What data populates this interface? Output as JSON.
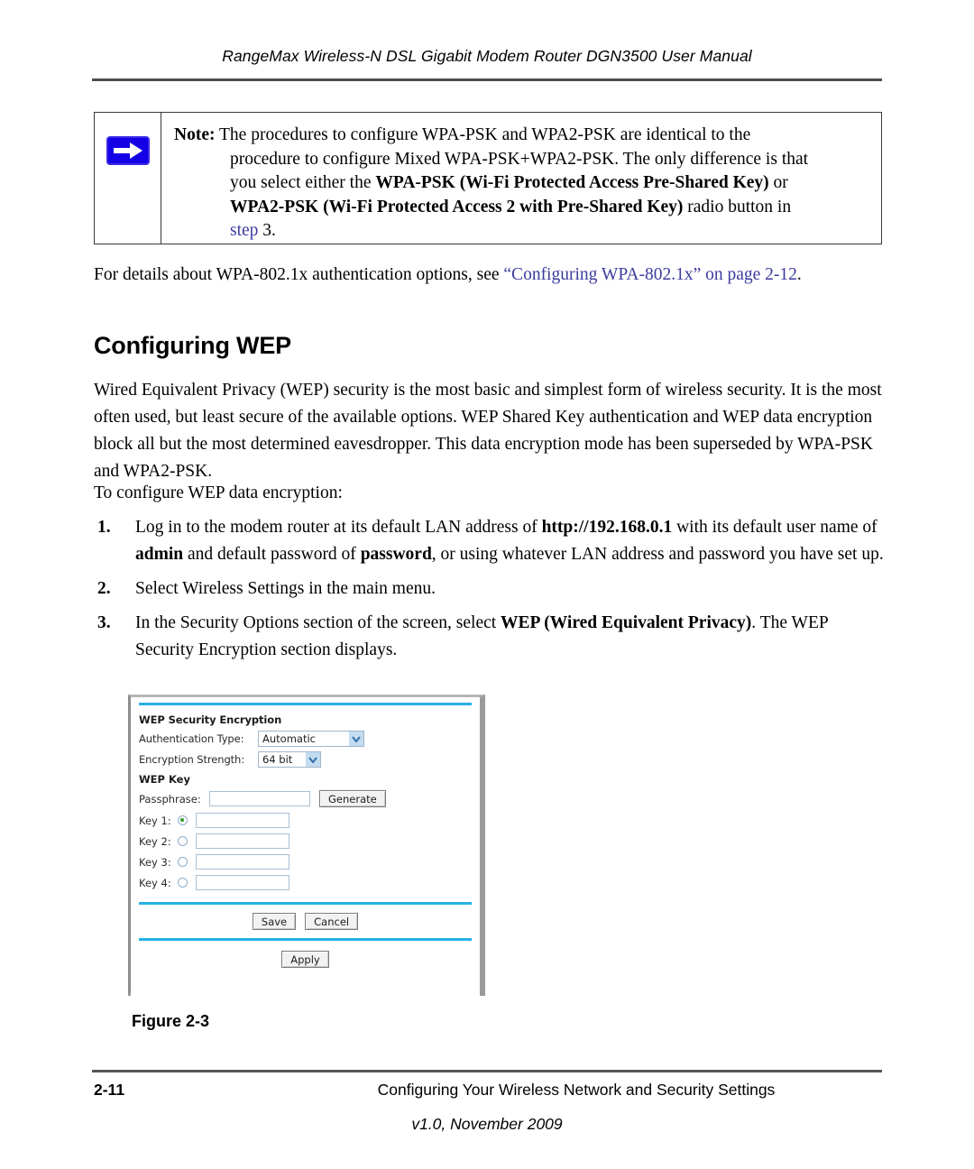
{
  "header": {
    "running_title": "RangeMax Wireless-N DSL Gigabit Modem Router DGN3500 User Manual"
  },
  "note": {
    "icon": "blue-right-arrow-icon",
    "label": "Note:",
    "line1_text": "The procedures to configure WPA-PSK and WPA2-PSK are identical to the",
    "line2_text": "procedure to configure Mixed WPA-PSK+WPA2-PSK. The only difference is that",
    "line3_prefix": "you select either the ",
    "line3_bold": "WPA-PSK (Wi-Fi Protected Access Pre-Shared Key)",
    "line3_suffix": " or",
    "line4_bold": "WPA2-PSK (Wi-Fi Protected Access 2 with Pre-Shared Key)",
    "line4_suffix": " radio button in",
    "line5_link": "step",
    "line5_rest": " 3."
  },
  "xref_para": {
    "before": "For details about WPA-802.1x authentication options, see ",
    "link1": "“Configuring WPA-802.1x” on",
    "link2": "page 2-12",
    "after": "."
  },
  "section": {
    "heading": "Configuring WEP"
  },
  "paragraphs": {
    "intro": "Wired Equivalent Privacy (WEP) security is the most basic and simplest form of wireless security. It is the most often used, but least secure of the available options. WEP Shared Key authentication and WEP data encryption block all but the most determined eavesdropper. This data encryption mode has been superseded by WPA-PSK and WPA2-PSK.",
    "to_configure": "To configure WEP data encryption:"
  },
  "steps": [
    {
      "number": "1.",
      "part1": "Log in to the modem router at its default LAN address of ",
      "bold1": "http://192.168.0.1",
      "part2": " with its default user name of ",
      "bold2": "admin",
      "part3": " and default password of ",
      "bold3": "password",
      "part4": ", or using whatever LAN address and password you have set up."
    },
    {
      "number": "2.",
      "part1": "Select Wireless Settings in the main menu.",
      "bold1": "",
      "part2": "",
      "bold2": "",
      "part3": "",
      "bold3": "",
      "part4": ""
    },
    {
      "number": "3.",
      "part1": "In the Security Options section of the screen, select ",
      "bold1": "WEP (Wired Equivalent Privacy)",
      "part2": ". The WEP Security Encryption section displays.",
      "bold2": "",
      "part3": "",
      "bold3": "",
      "part4": ""
    }
  ],
  "figure": {
    "caption": "Figure 2-3",
    "screenshot": {
      "title": "WEP Security Encryption",
      "auth_label": "Authentication Type:",
      "auth_value": "Automatic",
      "strength_label": "Encryption Strength:",
      "strength_value": "64 bit",
      "wep_key_title": "WEP Key",
      "passphrase_label": "Passphrase:",
      "passphrase_value": "",
      "generate_label": "Generate",
      "keys": [
        {
          "label": "Key 1:",
          "selected": true,
          "value": ""
        },
        {
          "label": "Key 2:",
          "selected": false,
          "value": ""
        },
        {
          "label": "Key 3:",
          "selected": false,
          "value": ""
        },
        {
          "label": "Key 4:",
          "selected": false,
          "value": ""
        }
      ],
      "save_label": "Save",
      "cancel_label": "Cancel",
      "apply_label": "Apply",
      "accent_color": "#27b0e6"
    }
  },
  "footer": {
    "page_number": "2-11",
    "chapter_title": "Configuring Your Wireless Network and Security Settings",
    "version": "v1.0, November 2009"
  }
}
